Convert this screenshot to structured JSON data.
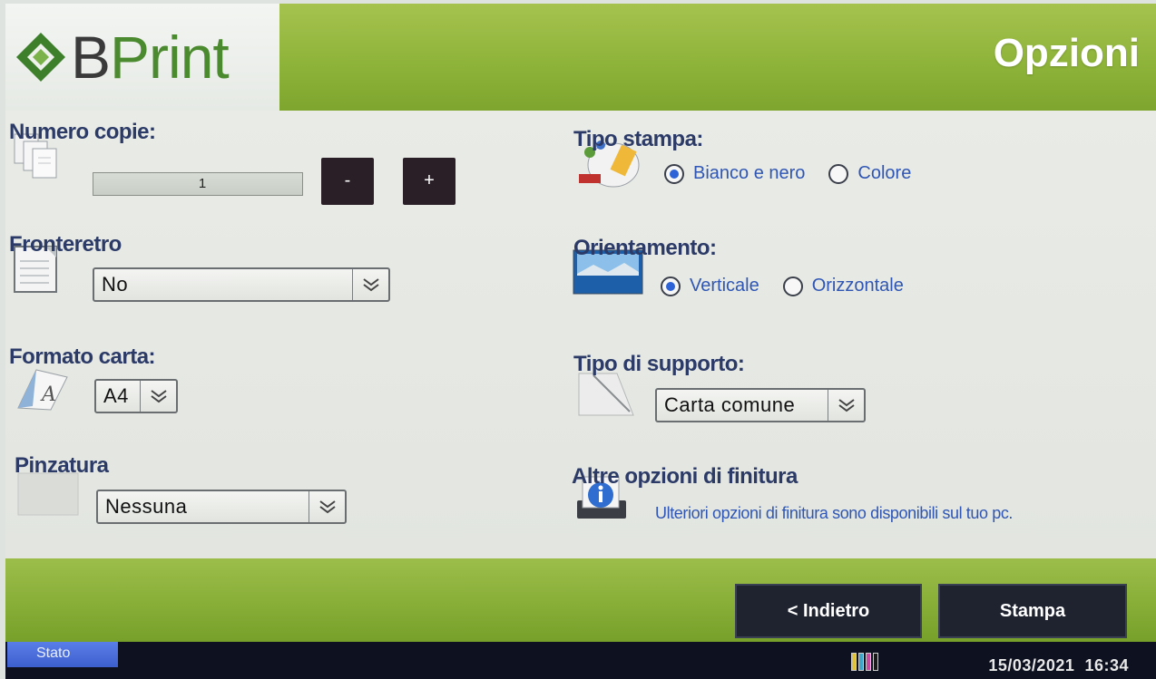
{
  "header": {
    "logo_text_accent": "B",
    "logo_text_main": "Print",
    "title": "Opzioni"
  },
  "options": {
    "copies": {
      "label": "Numero copie:",
      "value": "1",
      "minus_label": "-",
      "plus_label": "+",
      "icon": "copies-icon"
    },
    "duplex": {
      "label": "Fronteretro",
      "selected": "No",
      "icon": "duplex-icon"
    },
    "paper_size": {
      "label": "Formato carta:",
      "selected": "A4",
      "icon": "paper-format-icon"
    },
    "stapling": {
      "label": "Pinzatura",
      "selected": "Nessuna",
      "icon": "staple-icon"
    },
    "print_type": {
      "label": "Tipo stampa:",
      "icon": "print-color-icon",
      "choices": [
        {
          "label": "Bianco e nero",
          "selected": true
        },
        {
          "label": "Colore",
          "selected": false
        }
      ]
    },
    "orientation": {
      "label": "Orientamento:",
      "icon": "landscape-image-icon",
      "choices": [
        {
          "label": "Verticale",
          "selected": true
        },
        {
          "label": "Orizzontale",
          "selected": false
        }
      ]
    },
    "media_type": {
      "label": "Tipo di supporto:",
      "selected": "Carta comune",
      "icon": "paper-media-icon"
    },
    "finishing": {
      "label": "Altre opzioni di finitura",
      "info": "Ulteriori opzioni di finitura sono disponibili sul tuo pc.",
      "icon": "info-printer-icon"
    }
  },
  "footer": {
    "back_label": "< Indietro",
    "print_label": "Stampa"
  },
  "status_bar": {
    "status_label": "Stato",
    "date": "15/03/2021",
    "time": "16:34",
    "ink_icon": "ink-level-icon"
  },
  "colors": {
    "header_green": "#8fb43a",
    "label_navy": "#2b3a66",
    "radio_blue": "#2d63d6",
    "button_dark": "#1f2330",
    "status_blue": "#3d5fcf"
  }
}
